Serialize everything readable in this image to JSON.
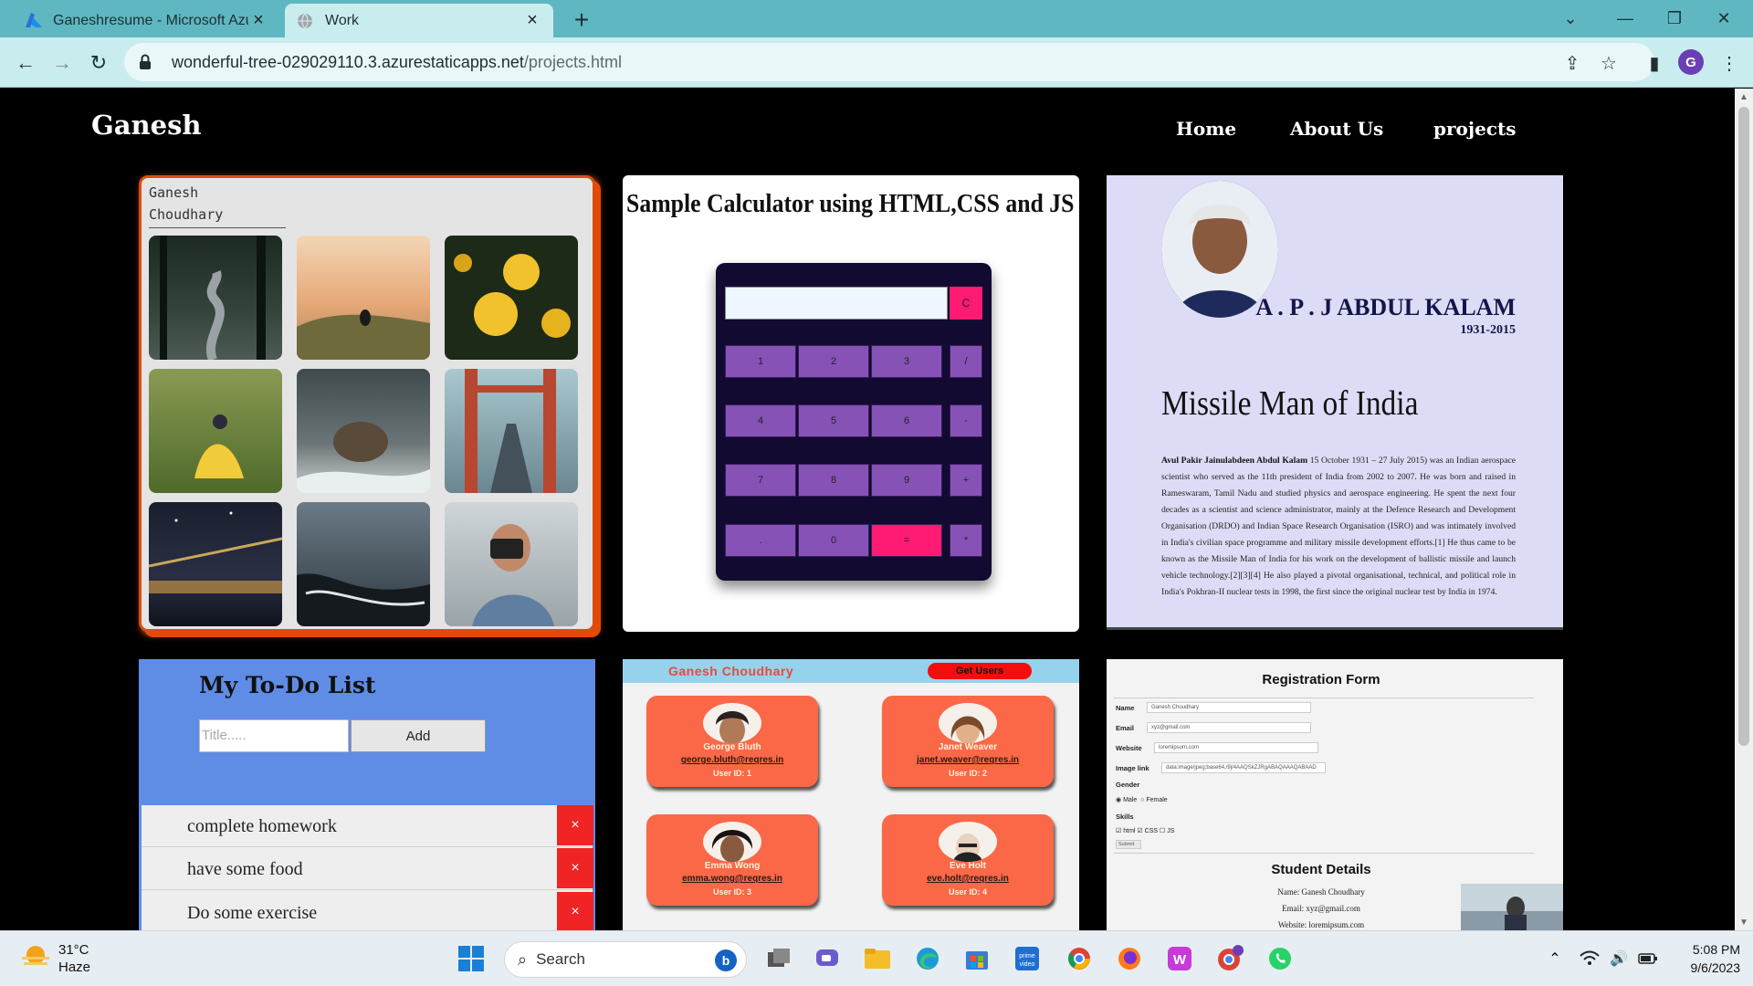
{
  "browser": {
    "tabs": [
      {
        "title": "Ganeshresume - Microsoft Azure",
        "active": false,
        "icon": "azure-icon"
      },
      {
        "title": "Work",
        "active": true,
        "icon": "globe-icon"
      }
    ],
    "url_host": "wonderful-tree-029029110.3.azurestaticapps.net",
    "url_path": "/projects.html",
    "profile_initial": "G"
  },
  "site": {
    "brand": "Ganesh",
    "nav": [
      "Home",
      "About Us",
      "projects"
    ]
  },
  "gallery": {
    "name_line1": "Ganesh",
    "name_line2": "Choudhary",
    "photos": [
      "forest-path",
      "bird-on-hill",
      "yellow-flowers",
      "woman-yellow-dress",
      "owl",
      "golden-gate-bridge",
      "city-bridge-night",
      "rocky-shore",
      "photographer"
    ]
  },
  "calculator": {
    "title": "Sample Calculator using HTML,CSS and JS",
    "clear_label": "C",
    "keys": [
      "1",
      "2",
      "3",
      "/",
      "4",
      "5",
      "6",
      "-",
      "7",
      "8",
      "9",
      "+",
      ".",
      "0",
      "=",
      "*"
    ]
  },
  "kalam": {
    "name": "A . P . J ABDUL KALAM",
    "years": "1931-2015",
    "headline": "Missile Man of India",
    "bio_name": "Avul Pakir Jainulabdeen Abdul Kalam",
    "bio": " 15 October 1931 – 27 July 2015) was an Indian aerospace scientist who served as the 11th president of India from 2002 to 2007. He was born and raised in Rameswaram, Tamil Nadu and studied physics and aerospace engineering. He spent the next four decades as a scientist and science administrator, mainly at the Defence Research and Development Organisation (DRDO) and Indian Space Research Organisation (ISRO) and was intimately involved in India's civilian space programme and military missile development efforts.[1] He thus came to be known as the Missile Man of India for his work on the development of ballistic missile and launch vehicle technology.[2][3][4] He also played a pivotal organisational, technical, and political role in India's Pokhran-II nuclear tests in 1998, the first since the original nuclear test by India in 1974."
  },
  "todo": {
    "title": "My To-Do List",
    "placeholder": "Title.....",
    "add_label": "Add",
    "items": [
      "complete homework",
      "have some food",
      "Do some exercise"
    ],
    "delete_label": "×"
  },
  "users": {
    "header": "Ganesh Choudhary",
    "button": "Get Users",
    "cards": [
      {
        "name": "George Bluth",
        "email": "george.bluth@reqres.in",
        "id": "User ID: 1"
      },
      {
        "name": "Janet Weaver",
        "email": "janet.weaver@reqres.in",
        "id": "User ID: 2"
      },
      {
        "name": "Emma Wong",
        "email": "emma.wong@reqres.in",
        "id": "User ID: 3"
      },
      {
        "name": "Eve Holt",
        "email": "eve.holt@reqres.in",
        "id": "User ID: 4"
      }
    ]
  },
  "registration": {
    "title": "Registration Form",
    "name_label": "Name",
    "name_value": "Ganesh Choudhary",
    "email_label": "Email",
    "email_value": "xyz@gmail.com",
    "website_label": "Website",
    "website_value": "loremipsum.com",
    "image_label": "Image link",
    "image_value": "data:image/jpeg;base64,/9j/4AAQSkZJRgABAQAAAQABAAD",
    "gender_label": "Gender",
    "male": "Male",
    "female": "Female",
    "skills_label": "Skills",
    "skill1": "html",
    "skill2": "CSS",
    "skill3": "JS",
    "submit": "Submit",
    "details_title": "Student Details",
    "details_name": "Name: Ganesh Choudhary",
    "details_email": "Email: xyz@gmail.com",
    "details_website": "Website: loremipsum.com"
  },
  "taskbar": {
    "temperature": "31°C",
    "condition": "Haze",
    "search_label": "Search",
    "time": "5:08 PM",
    "date": "9/6/2023"
  },
  "colors": {
    "tabbar": "#5fb7c1",
    "addressbar": "#c9ecef",
    "gallery_border": "#e04a10",
    "calc_body": "#120a30",
    "calc_key": "#8752b6",
    "calc_accent": "#ff1b72",
    "todo_bg": "#5f8de6",
    "user_card": "#fa6848"
  }
}
